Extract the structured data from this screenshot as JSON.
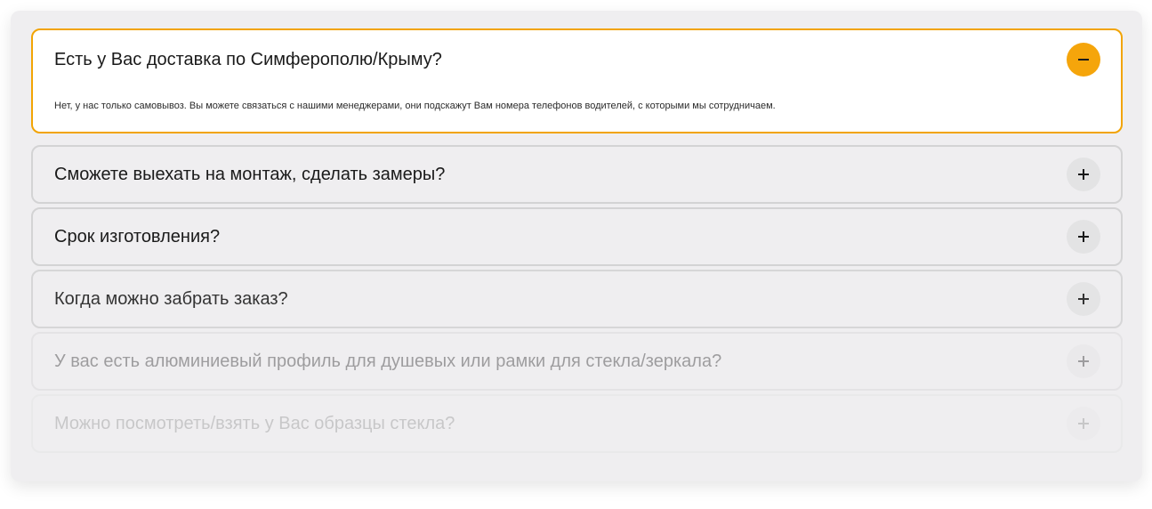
{
  "faq": {
    "items": [
      {
        "question": "Есть у Вас доставка по Симферополю/Крыму?",
        "answer": "Нет, у нас только самовывоз. Вы можете связаться с нашими менеджерами, они подскажут Вам номера телефонов водителей, с которыми мы сотрудничаем.",
        "expanded": true,
        "toggle_icon": "minus-icon"
      },
      {
        "question": "Сможете выехать на монтаж, сделать замеры?",
        "expanded": false,
        "toggle_icon": "plus-icon"
      },
      {
        "question": "Срок изготовления?",
        "expanded": false,
        "toggle_icon": "plus-icon"
      },
      {
        "question": "Когда можно забрать заказ?",
        "expanded": false,
        "toggle_icon": "plus-icon"
      },
      {
        "question": "У вас есть алюминиевый профиль для душевых или рамки для стекла/зеркала?",
        "expanded": false,
        "toggle_icon": "plus-icon"
      },
      {
        "question": "Можно посмотреть/взять у Вас образцы стекла?",
        "expanded": false,
        "toggle_icon": "plus-icon"
      }
    ]
  },
  "colors": {
    "accent": "#f5a50b",
    "open_border": "#f2a404",
    "panel_bg": "#efeef0",
    "item_border": "#d3d3d4"
  }
}
